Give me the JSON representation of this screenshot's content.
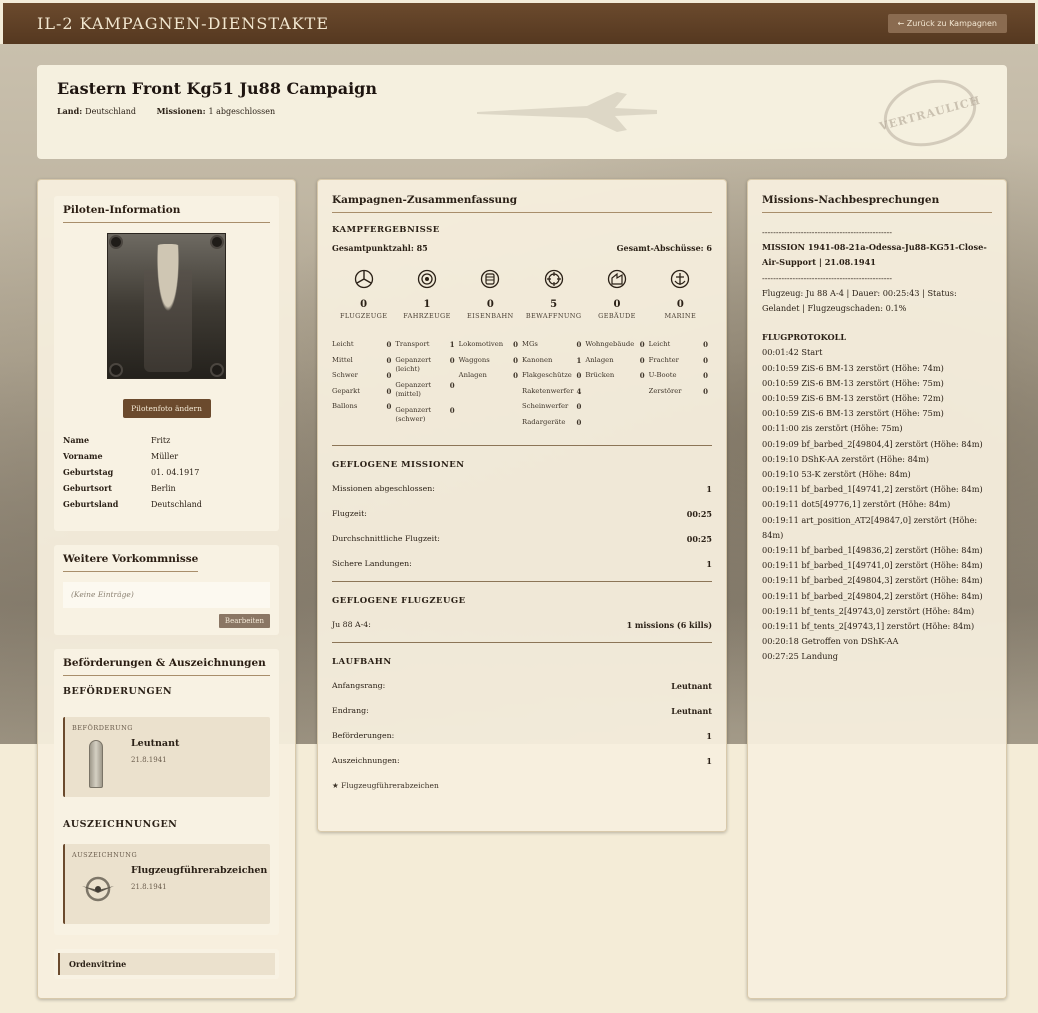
{
  "nav": {
    "title": "IL-2 KAMPAGNEN-DIENSTAKTE",
    "back_label": "← Zurück zu Kampagnen"
  },
  "header": {
    "title": "Eastern Front Kg51 Ju88 Campaign",
    "land_label": "Land:",
    "land_value": "Deutschland",
    "missions_label": "Missionen:",
    "missions_value": "1 abgeschlossen",
    "stamp_text": "VERTRAULICH"
  },
  "pilot": {
    "heading": "Piloten-Information",
    "photo_button": "Pilotenfoto ändern",
    "fields": [
      {
        "label": "Name",
        "value": "Fritz"
      },
      {
        "label": "Vorname",
        "value": "Müller"
      },
      {
        "label": "Geburtstag",
        "value": "01. 04.1917"
      },
      {
        "label": "Geburtsort",
        "value": "Berlin"
      },
      {
        "label": "Geburtsland",
        "value": "Deutschland"
      }
    ]
  },
  "incidents": {
    "heading": "Weitere Vorkommnisse",
    "empty": "(Keine Einträge)",
    "edit_button": "Bearbeiten"
  },
  "promotions": {
    "heading": "Beförderungen & Auszeichnungen",
    "promo_section": "BEFÖRDERUNGEN",
    "promo": {
      "kind": "BEFÖRDERUNG",
      "name": "Leutnant",
      "date": "21.8.1941"
    },
    "award_section": "AUSZEICHNUNGEN",
    "award": {
      "kind": "AUSZEICHNUNG",
      "name": "Flugzeugführerabzeichen",
      "date": "21.8.1941"
    },
    "showcase": "Ordenvitrine"
  },
  "summary": {
    "heading": "Kampagnen-Zusammenfassung",
    "combat_label": "KAMPFERGEBNISSE",
    "total_points_label": "Gesamtpunktzahl:",
    "total_points": "85",
    "total_kills_label": "Gesamt-Abschüsse:",
    "total_kills": "6",
    "categories": [
      {
        "icon": "aircraft-icon",
        "num": "0",
        "label": "FLUGZEUGE"
      },
      {
        "icon": "vehicle-icon",
        "num": "1",
        "label": "FAHRZEUGE"
      },
      {
        "icon": "railway-icon",
        "num": "0",
        "label": "EISENBAHN"
      },
      {
        "icon": "weapons-icon",
        "num": "5",
        "label": "BEWAFFNUNG"
      },
      {
        "icon": "building-icon",
        "num": "0",
        "label": "GEBÄUDE"
      },
      {
        "icon": "anchor-icon",
        "num": "0",
        "label": "MARINE"
      }
    ],
    "breakdown": [
      [
        {
          "l": "Leicht",
          "v": "0"
        },
        {
          "l": "Mittel",
          "v": "0"
        },
        {
          "l": "Schwer",
          "v": "0"
        },
        {
          "l": "Geparkt",
          "v": "0"
        },
        {
          "l": "Ballons",
          "v": "0"
        }
      ],
      [
        {
          "l": "Transport",
          "v": "1"
        },
        {
          "l": "Gepanzert (leicht)",
          "v": "0"
        },
        {
          "l": "Gepanzert (mittel)",
          "v": "0"
        },
        {
          "l": "Gepanzert (schwer)",
          "v": "0"
        }
      ],
      [
        {
          "l": "Lokomotiven",
          "v": "0"
        },
        {
          "l": "Waggons",
          "v": "0"
        },
        {
          "l": "Anlagen",
          "v": "0"
        }
      ],
      [
        {
          "l": "MGs",
          "v": "0"
        },
        {
          "l": "Kanonen",
          "v": "1"
        },
        {
          "l": "Flakgeschütze",
          "v": "0"
        },
        {
          "l": "Raketenwerfer",
          "v": "4"
        },
        {
          "l": "Scheinwerfer",
          "v": "0"
        },
        {
          "l": "Radargeräte",
          "v": "0"
        }
      ],
      [
        {
          "l": "Wohngebäude",
          "v": "0"
        },
        {
          "l": "Anlagen",
          "v": "0"
        },
        {
          "l": "Brücken",
          "v": "0"
        }
      ],
      [
        {
          "l": "Leicht",
          "v": "0"
        },
        {
          "l": "Frachter",
          "v": "0"
        },
        {
          "l": "U-Boote",
          "v": "0"
        },
        {
          "l": "Zerstörer",
          "v": "0"
        }
      ]
    ],
    "missions_label": "GEFLOGENE MISSIONEN",
    "missions": [
      {
        "l": "Missionen abgeschlossen:",
        "v": "1"
      },
      {
        "l": "Flugzeit:",
        "v": "00:25"
      },
      {
        "l": "Durchschnittliche Flugzeit:",
        "v": "00:25"
      },
      {
        "l": "Sichere Landungen:",
        "v": "1"
      }
    ],
    "aircraft_label": "GEFLOGENE FLUGZEUGE",
    "aircraft": [
      {
        "l": "Ju 88 A-4:",
        "v": "1 missions (6 kills)"
      }
    ],
    "career_label": "LAUFBAHN",
    "career": [
      {
        "l": "Anfangsrang:",
        "v": "Leutnant"
      },
      {
        "l": "Endrang:",
        "v": "Leutnant"
      },
      {
        "l": "Beförderungen:",
        "v": "1"
      },
      {
        "l": "Auszeichnungen:",
        "v": "1"
      }
    ],
    "career_award": "Flugzeugführerabzeichen"
  },
  "debrief": {
    "heading": "Missions-Nachbesprechungen",
    "separator": "-----------------------------------------------",
    "mission_title": "MISSION 1941-08-21a-Odessa-Ju88-KG51-Close-Air-Support | 21.08.1941",
    "mission_meta": "Flugzeug: Ju 88 A-4 | Dauer: 00:25:43 | Status: Gelandet | Flugzeugschaden: 0.1%",
    "log_heading": "FLUGPROTOKOLL",
    "log": [
      "00:01:42 Start",
      "00:10:59 ZiS-6 BM-13 zerstört (Höhe: 74m)",
      "00:10:59 ZiS-6 BM-13 zerstört (Höhe: 75m)",
      "00:10:59 ZiS-6 BM-13 zerstört (Höhe: 72m)",
      "00:10:59 ZiS-6 BM-13 zerstört (Höhe: 75m)",
      "00:11:00 zis zerstört (Höhe: 75m)",
      "00:19:09 bf_barbed_2[49804,4] zerstört (Höhe: 84m)",
      "00:19:10 DShK-AA zerstört (Höhe: 84m)",
      "00:19:10 53-K zerstört (Höhe: 84m)",
      "00:19:11 bf_barbed_1[49741,2] zerstört (Höhe: 84m)",
      "00:19:11 dot5[49776,1] zerstört (Höhe: 84m)",
      "00:19:11 art_position_AT2[49847,0] zerstört (Höhe: 84m)",
      "00:19:11 bf_barbed_1[49836,2] zerstört (Höhe: 84m)",
      "00:19:11 bf_barbed_1[49741,0] zerstört (Höhe: 84m)",
      "00:19:11 bf_barbed_2[49804,3] zerstört (Höhe: 84m)",
      "00:19:11 bf_barbed_2[49804,2] zerstört (Höhe: 84m)",
      "00:19:11 bf_tents_2[49743,0] zerstört (Höhe: 84m)",
      "00:19:11 bf_tents_2[49743,1] zerstört (Höhe: 84m)",
      "00:20:18 Getroffen von DShK-AA",
      "00:27:25 Landung"
    ]
  },
  "colors": {
    "nav_brown": "#5f4127",
    "accent_brown": "#6b4a2d",
    "paper": "#f6efde"
  }
}
